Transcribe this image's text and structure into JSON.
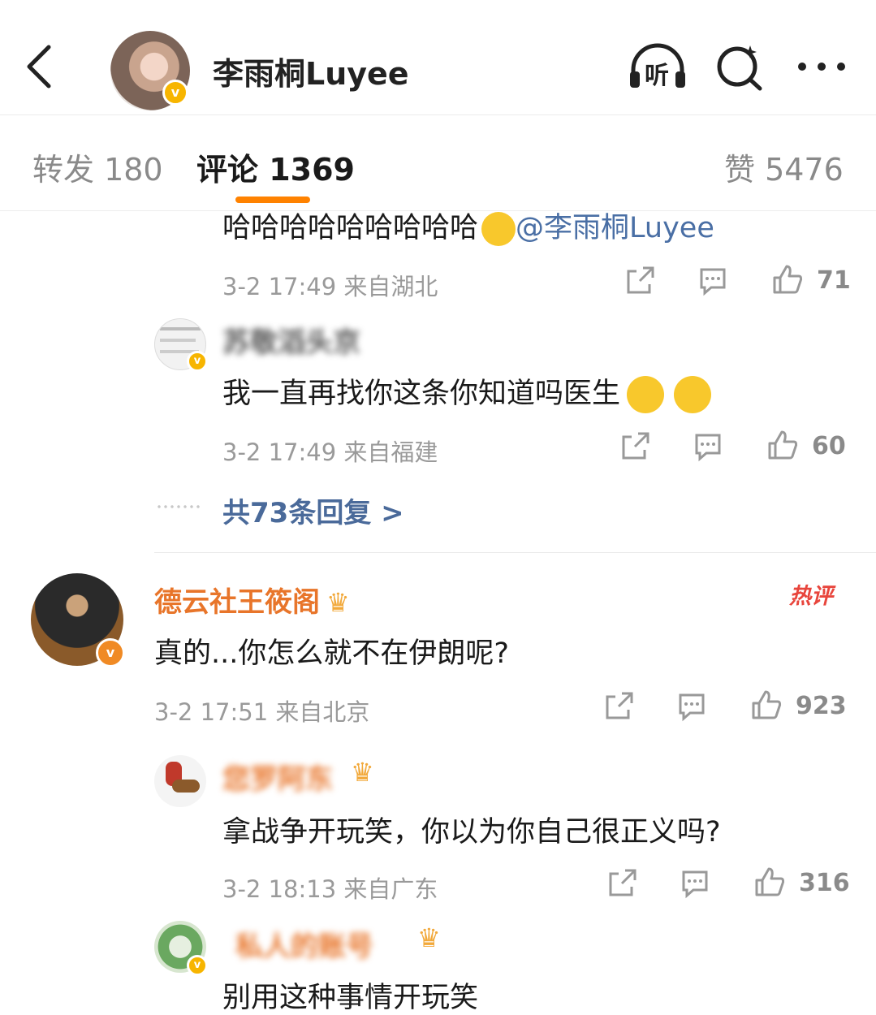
{
  "header": {
    "title": "李雨桐Luyee",
    "listen_label": "听"
  },
  "tabs": [
    {
      "label": "转发 180"
    },
    {
      "label": "评论 1369"
    },
    {
      "label": "赞 5476"
    }
  ],
  "comments": [
    {
      "text": "哈哈哈哈哈哈哈哈哈",
      "mention": "@李雨桐Luyee",
      "meta": "3-2 17:49 来自湖北",
      "likes": "71"
    },
    {
      "username": "苏敬滔头京",
      "text": "我一直再找你这条你知道吗医生",
      "meta": "3-2 17:49 来自福建",
      "likes": "60"
    },
    {
      "replies_link": "共73条回复 >"
    },
    {
      "username": "德云社王筱阁",
      "badge": "热评",
      "text": "真的...你怎么就不在伊朗呢?",
      "meta": "3-2 17:51 来自北京",
      "likes": "923"
    },
    {
      "username": "您罗阿东",
      "text": "拿战争开玩笑，你以为你自己很正义吗?",
      "meta": "3-2 18:13 来自广东",
      "likes": "316"
    },
    {
      "username": "私人的账号",
      "text": "别用这种事情开玩笑"
    }
  ]
}
